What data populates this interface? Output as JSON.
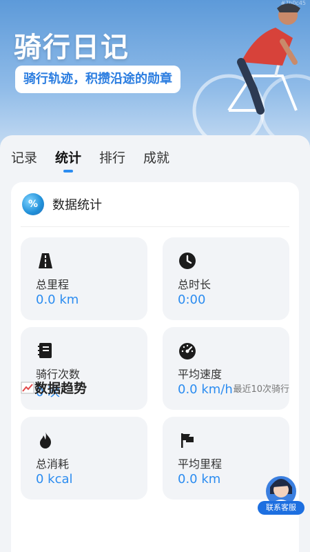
{
  "hero": {
    "app_title": "骑行日记",
    "slogan": "骑行轨迹，积攒沿途的勋章",
    "corner_mark": "#7b0c45"
  },
  "tabs": [
    {
      "label": "记录",
      "active": false
    },
    {
      "label": "统计",
      "active": true
    },
    {
      "label": "排行",
      "active": false
    },
    {
      "label": "成就",
      "active": false
    }
  ],
  "stats_card": {
    "title": "数据统计",
    "icon": "stats-badge-icon",
    "items": [
      {
        "label": "总里程",
        "value": "0.0 km",
        "icon": "road-icon"
      },
      {
        "label": "总时长",
        "value": "0:00",
        "icon": "clock-icon"
      },
      {
        "label": "骑行次数",
        "value": "0 次",
        "icon": "notebook-icon"
      },
      {
        "label": "平均速度",
        "value": "0.0 km/h",
        "icon": "speedometer-icon"
      },
      {
        "label": "总消耗",
        "value": "0 kcal",
        "icon": "flame-icon"
      },
      {
        "label": "平均里程",
        "value": "0.0 km",
        "icon": "flag-icon"
      }
    ]
  },
  "trend": {
    "title": "数据趋势",
    "subtitle": "最近10次骑行",
    "icon": "chart-trend-icon"
  },
  "support": {
    "label": "联系客服"
  },
  "colors": {
    "accent": "#2b8cf0",
    "slogan_text": "#2b7de0",
    "support_bg": "#1d6fe0"
  }
}
